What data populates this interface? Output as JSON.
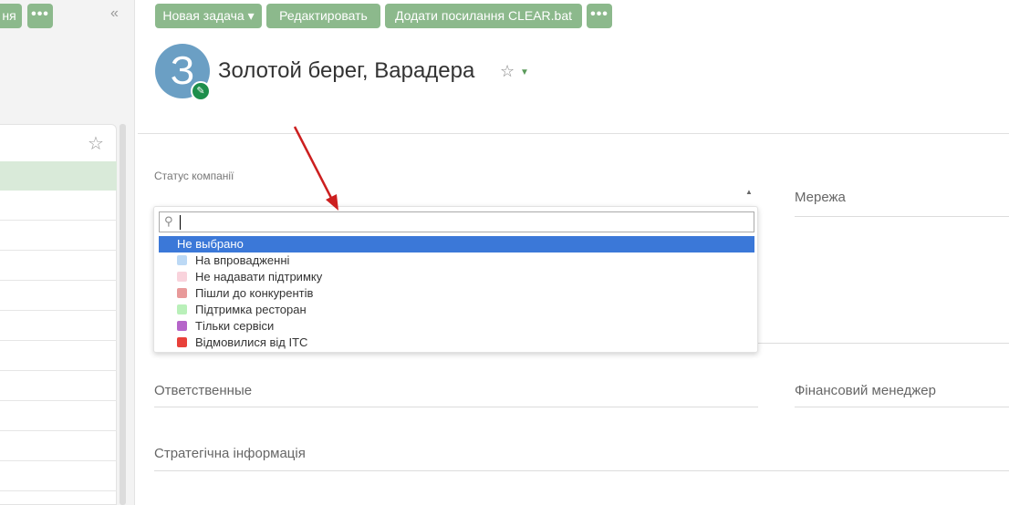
{
  "sidebar": {
    "partial_button_label": "ня",
    "more_label": "•••",
    "collapse_label": "«"
  },
  "toolbar": {
    "new_task_label": "Новая задача ▾",
    "edit_label": "Редактировать",
    "add_link_label": "Додати посилання CLEAR.bat",
    "more_label": "•••"
  },
  "header": {
    "avatar_letter": "З",
    "title": "Золотой берег, Варадера",
    "star_icon": "star-icon",
    "caret_icon": "chevron-down-icon"
  },
  "form": {
    "status_label": "Статус компанії",
    "network_label": "Мережа",
    "responsible_label": "Ответственные",
    "finance_manager_label": "Фінансовий менеджер",
    "strategic_info_label": "Стратегічна інформація"
  },
  "dropdown": {
    "search_value": "",
    "options": [
      {
        "label": "Не выбрано",
        "selected": true,
        "color": ""
      },
      {
        "label": "На впровадженні",
        "selected": false,
        "color": "#bcd9f5"
      },
      {
        "label": "Не надавати підтримку",
        "selected": false,
        "color": "#f9d3dc"
      },
      {
        "label": "Пішли до конкурентів",
        "selected": false,
        "color": "#e89a9a"
      },
      {
        "label": "Підтримка ресторан",
        "selected": false,
        "color": "#b9f0b9"
      },
      {
        "label": "Тільки сервіси",
        "selected": false,
        "color": "#b565c9"
      },
      {
        "label": "Відмовилися від ІТС",
        "selected": false,
        "color": "#e8413a"
      }
    ]
  },
  "colors": {
    "button_green": "#8cb98c",
    "selected_option_blue": "#3b78d8",
    "avatar_blue": "#6b9fc4",
    "annotation_arrow_red": "#cc1f1f"
  }
}
